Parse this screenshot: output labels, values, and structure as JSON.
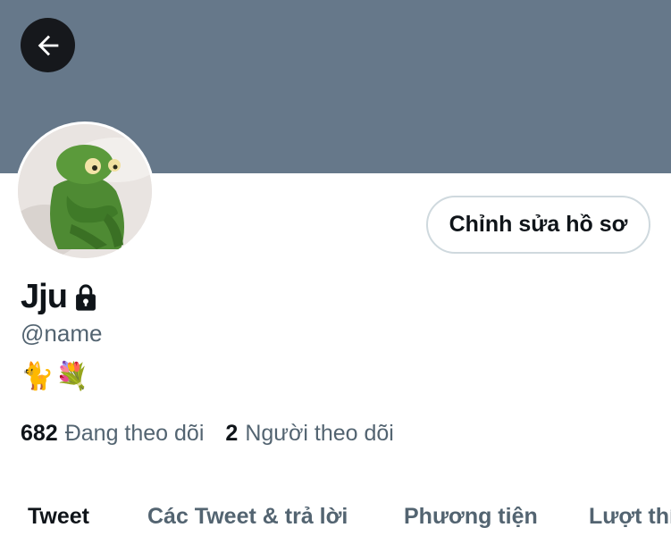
{
  "header": {
    "back_icon": "arrow-left-icon",
    "banner_color": "#66788a"
  },
  "profile": {
    "display_name": "Jju",
    "lock_icon": "lock-icon",
    "handle": "@name",
    "bio": "🐈💐",
    "edit_button_label": "Chỉnh sửa hồ sơ"
  },
  "stats": {
    "following_count": "682",
    "following_label": "Đang theo dõi",
    "followers_count": "2",
    "followers_label": "Người theo dõi"
  },
  "tabs": [
    {
      "label": "Tweet",
      "active": true
    },
    {
      "label": "Các Tweet & trả lời",
      "active": false
    },
    {
      "label": "Phương tiện",
      "active": false
    },
    {
      "label": "Lượt thích",
      "active": false
    }
  ],
  "colors": {
    "text_primary": "#0f1419",
    "text_secondary": "#536471",
    "border": "#cfd9de"
  }
}
